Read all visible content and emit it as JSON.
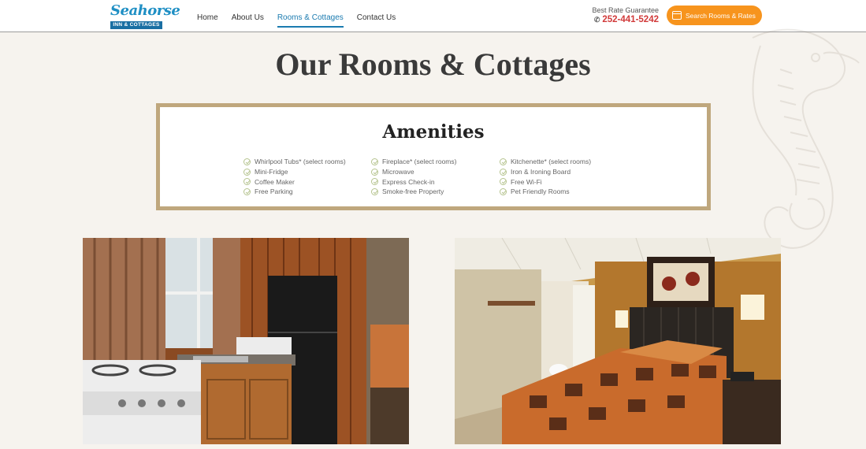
{
  "brand": {
    "logo_script": "Seahorse",
    "logo_band": "INN & COTTAGES"
  },
  "nav": {
    "items": [
      {
        "label": "Home"
      },
      {
        "label": "About Us"
      },
      {
        "label": "Rooms & Cottages",
        "active": true
      },
      {
        "label": "Contact Us"
      }
    ]
  },
  "header": {
    "guarantee": "Best Rate Guarantee",
    "phone": "252-441-5242",
    "phone_icon": "phone-icon",
    "cta_label": "Search Rooms & Rates",
    "cta_icon": "calendar-icon",
    "cta_color": "#f7941d",
    "phone_color": "#d13a3a",
    "accent": "#1b7bb0"
  },
  "page": {
    "title": "Our Rooms & Cottages"
  },
  "amenities": {
    "heading": "Amenities",
    "columns": [
      [
        "Whirlpool Tubs* (select rooms)",
        "Mini-Fridge",
        "Coffee Maker",
        "Free Parking"
      ],
      [
        "Fireplace* (select rooms)",
        "Microwave",
        "Express Check-in",
        "Smoke-free Property"
      ],
      [
        "Kitchenette* (select rooms)",
        "Iron & Ironing Board",
        "Free Wi-Fi",
        "Pet Friendly Rooms"
      ]
    ],
    "border_color": "#bfa77d"
  },
  "photos": {
    "left_name": "kitchenette-photo",
    "right_name": "bedroom-photo"
  }
}
